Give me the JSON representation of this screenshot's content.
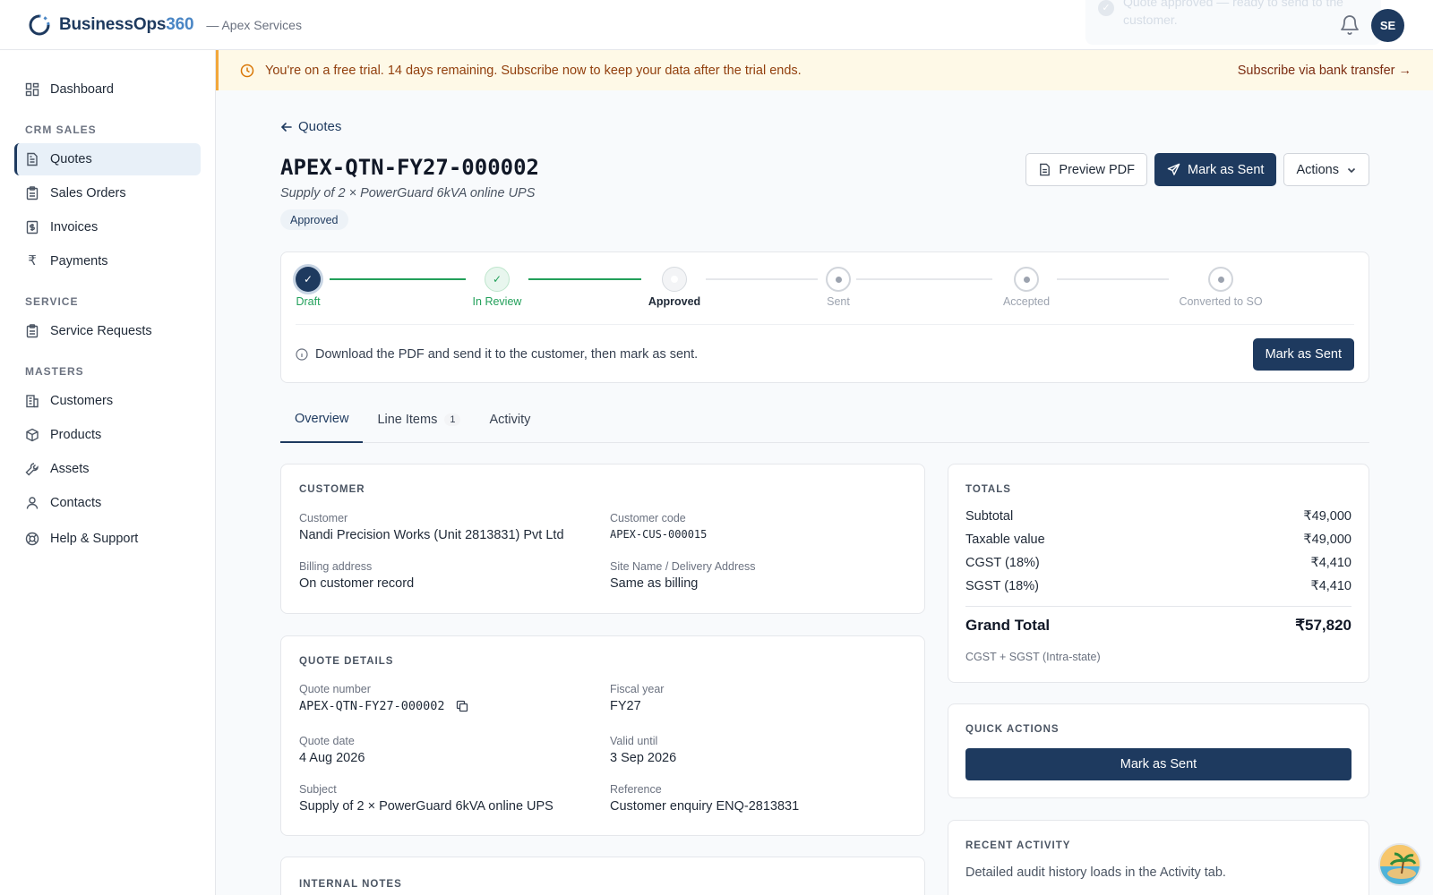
{
  "app": {
    "brand_name": "BusinessOps",
    "brand_number": "360",
    "org": "— Apex Services",
    "user_initials": "SE"
  },
  "toast": {
    "message": "Quote approved — ready to send to the customer."
  },
  "banner": {
    "message": "You're on a free trial. 14 days remaining. Subscribe now to keep your data after the trial ends.",
    "cta": "Subscribe via bank transfer →"
  },
  "sidebar": {
    "dashboard": "Dashboard",
    "sections": [
      {
        "title": "CRM SALES",
        "items": [
          "Quotes",
          "Sales Orders",
          "Invoices",
          "Payments"
        ]
      },
      {
        "title": "SERVICE",
        "items": [
          "Service Requests"
        ]
      },
      {
        "title": "MASTERS",
        "items": [
          "Customers",
          "Products",
          "Assets",
          "Contacts"
        ]
      }
    ],
    "help": "Help & Support",
    "active_item": "Quotes"
  },
  "page": {
    "back_label": "Quotes",
    "quote_id": "APEX-QTN-FY27-000002",
    "subtitle": "Supply of 2 × PowerGuard 6kVA online UPS",
    "status": "Approved",
    "preview_pdf": "Preview PDF",
    "mark_sent": "Mark as Sent",
    "actions": "Actions"
  },
  "stepper": {
    "steps": [
      {
        "label": "Draft",
        "state": "done"
      },
      {
        "label": "In Review",
        "state": "done"
      },
      {
        "label": "Approved",
        "state": "current"
      },
      {
        "label": "Sent",
        "state": "pending"
      },
      {
        "label": "Accepted",
        "state": "pending"
      },
      {
        "label": "Converted to SO",
        "state": "pending"
      }
    ],
    "hint": "Download the PDF and send it to the customer, then mark as sent.",
    "button": "Mark as Sent"
  },
  "tabs": [
    {
      "label": "Overview",
      "active": true
    },
    {
      "label": "Line Items",
      "count": "1"
    },
    {
      "label": "Activity"
    }
  ],
  "customer": {
    "section_title": "CUSTOMER",
    "customer_label": "Customer",
    "customer_value": "Nandi Precision Works (Unit 2813831) Pvt Ltd",
    "code_label": "Customer code",
    "code_value": "APEX-CUS-000015",
    "billing_label": "Billing address",
    "billing_value": "On customer record",
    "site_label": "Site Name / Delivery Address",
    "site_value": "Same as billing"
  },
  "quote_details": {
    "section_title": "QUOTE DETAILS",
    "number_label": "Quote number",
    "number_value": "APEX-QTN-FY27-000002",
    "fy_label": "Fiscal year",
    "fy_value": "FY27",
    "date_label": "Quote date",
    "date_value": "4 Aug 2026",
    "valid_label": "Valid until",
    "valid_value": "3 Sep 2026",
    "subject_label": "Subject",
    "subject_value": "Supply of 2 × PowerGuard 6kVA online UPS",
    "ref_label": "Reference",
    "ref_value": "Customer enquiry ENQ-2813831"
  },
  "internal_notes": {
    "section_title": "INTERNAL NOTES"
  },
  "totals": {
    "section_title": "TOTALS",
    "rows": [
      {
        "label": "Subtotal",
        "value": "₹49,000"
      },
      {
        "label": "Taxable value",
        "value": "₹49,000"
      },
      {
        "label": "CGST (18%)",
        "value": "₹4,410"
      },
      {
        "label": "SGST (18%)",
        "value": "₹4,410"
      }
    ],
    "grand_label": "Grand Total",
    "grand_value": "₹57,820",
    "note": "CGST + SGST (Intra-state)"
  },
  "quick_actions": {
    "section_title": "QUICK ACTIONS",
    "button": "Mark as Sent"
  },
  "recent_activity": {
    "section_title": "RECENT ACTIVITY",
    "message": "Detailed audit history loads in the Activity tab."
  },
  "colors": {
    "brand": "#1e3a5f",
    "accent": "#4a86c5",
    "success": "#22a05a",
    "warning_bg": "#fef9e7"
  }
}
